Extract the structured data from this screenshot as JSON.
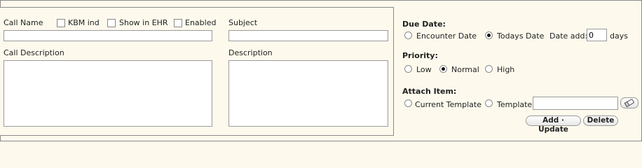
{
  "call": {
    "call_name_label": "Call Name",
    "kbm_ind_label": "KBM ind",
    "show_in_ehr_label": "Show in EHR",
    "enabled_label": "Enabled",
    "subject_label": "Subject",
    "call_description_label": "Call Description",
    "description_label": "Description",
    "call_name_value": "",
    "subject_value": "",
    "call_description_value": "",
    "description_value": "",
    "kbm_ind_checked": false,
    "show_in_ehr_checked": false,
    "enabled_checked": false
  },
  "due_date": {
    "label": "Due Date:",
    "encounter_date_label": "Encounter Date",
    "todays_date_label": "Todays Date",
    "selected": "Todays Date",
    "date_add_label": "Date add:",
    "date_add_value": "0",
    "days_label": "days"
  },
  "priority": {
    "label": "Priority:",
    "low_label": "Low",
    "normal_label": "Normal",
    "high_label": "High",
    "selected": "Normal"
  },
  "attach_item": {
    "label": "Attach Item:",
    "current_template_label": "Current Template",
    "template_label": "Template",
    "template_value": "",
    "selected": "none"
  },
  "actions": {
    "add_update_label": "Add · Update",
    "delete_label": "Delete"
  },
  "icons": {
    "eraser": "eraser-icon"
  }
}
